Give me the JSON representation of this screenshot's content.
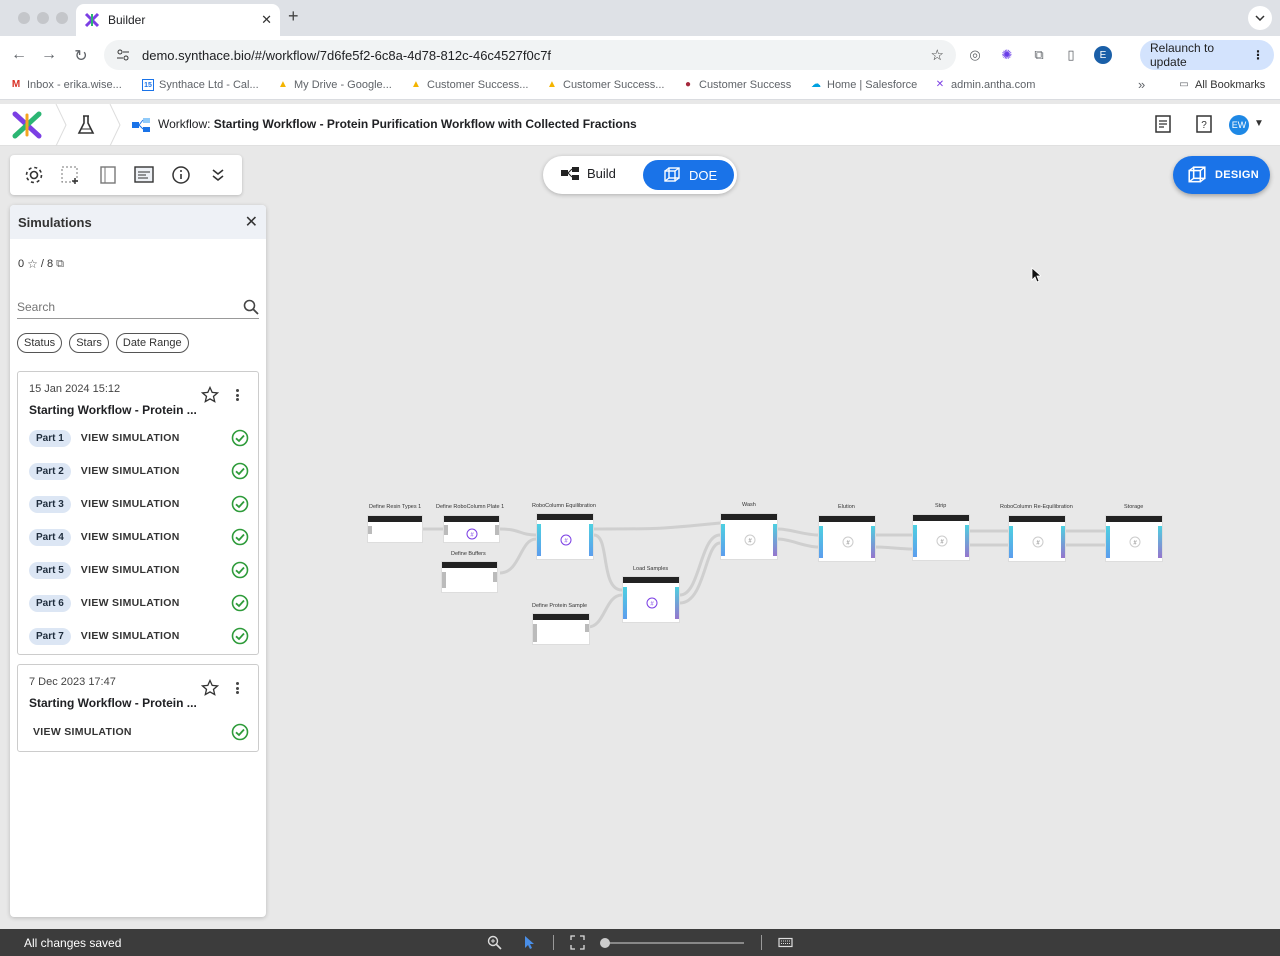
{
  "browser": {
    "tab_title": "Builder",
    "tab_close": "✕",
    "new_tab": "+",
    "url": "demo.synthace.bio/#/workflow/7d6fe5f2-6c8a-4d78-812c-46c4527f0c7f",
    "profile_initial": "E",
    "relaunch_label": "Relaunch to update",
    "relaunch_menu": "⋮",
    "bookmarks": [
      {
        "label": "Inbox - erika.wise...",
        "icon": "gmail-icon"
      },
      {
        "label": "Synthace Ltd - Cal...",
        "icon": "calendar-icon"
      },
      {
        "label": "My Drive - Google...",
        "icon": "drive-icon"
      },
      {
        "label": "Customer Success...",
        "icon": "drive-icon"
      },
      {
        "label": "Customer Success...",
        "icon": "drive-icon"
      },
      {
        "label": "Customer Success",
        "icon": "person-icon"
      },
      {
        "label": "Home | Salesforce",
        "icon": "salesforce-icon"
      },
      {
        "label": "admin.antha.com",
        "icon": "synthace-icon"
      }
    ],
    "bookmarks_more": "»",
    "all_bookmarks": "All Bookmarks"
  },
  "header": {
    "workflow_prefix": "Workflow:",
    "workflow_title": "Starting Workflow - Protein Purification Workflow with Collected Fractions",
    "avatar_initials": "EW"
  },
  "mode": {
    "build_label": "Build",
    "doe_label": "DOE",
    "active": "DOE"
  },
  "design_button": "DESIGN",
  "simulations": {
    "title": "Simulations",
    "stars_count": "0",
    "total_count": "/ 8",
    "search_placeholder": "Search",
    "filters": [
      "Status",
      "Stars",
      "Date Range"
    ],
    "cards": [
      {
        "date": "15 Jan 2024 15:12",
        "name": "Starting Workflow - Protein ...",
        "parts": [
          {
            "part": "Part 1",
            "link": "VIEW SIMULATION"
          },
          {
            "part": "Part 2",
            "link": "VIEW SIMULATION"
          },
          {
            "part": "Part 3",
            "link": "VIEW SIMULATION"
          },
          {
            "part": "Part 4",
            "link": "VIEW SIMULATION"
          },
          {
            "part": "Part 5",
            "link": "VIEW SIMULATION"
          },
          {
            "part": "Part 6",
            "link": "VIEW SIMULATION"
          },
          {
            "part": "Part 7",
            "link": "VIEW SIMULATION"
          }
        ]
      },
      {
        "date": "7 Dec 2023 17:47",
        "name": "Starting Workflow - Protein ...",
        "link": "VIEW SIMULATION"
      }
    ]
  },
  "graph": {
    "nodes": [
      {
        "label": "Define Resin Types 1"
      },
      {
        "label": "Define RoboColumn Plate 1"
      },
      {
        "label": "Define Buffers"
      },
      {
        "label": "RoboColumn Equilibration"
      },
      {
        "label": "Define Protein Sample"
      },
      {
        "label": "Load Samples"
      },
      {
        "label": "Wash"
      },
      {
        "label": "Elution"
      },
      {
        "label": "Strip"
      },
      {
        "label": "RoboColumn Re-Equilibration"
      },
      {
        "label": "Storage"
      }
    ]
  },
  "status": {
    "text": "All changes saved"
  },
  "colors": {
    "accent": "#1a73e8",
    "success": "#2e9b3a",
    "port_cyan": "#4dd0e1"
  }
}
